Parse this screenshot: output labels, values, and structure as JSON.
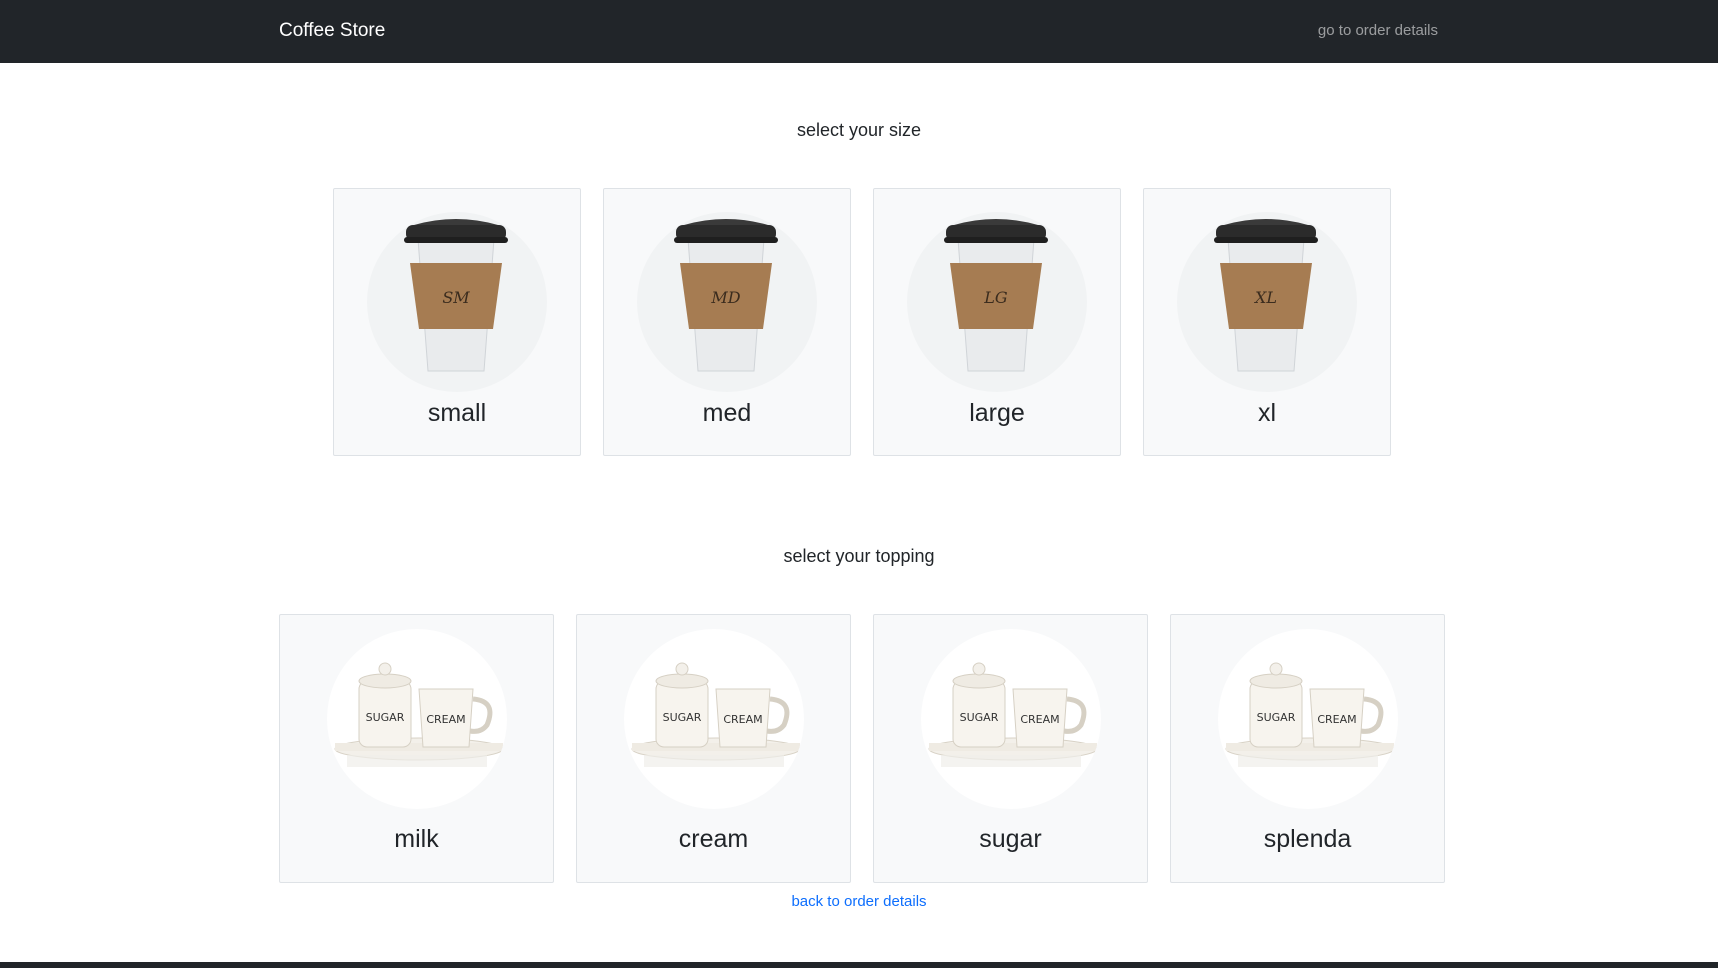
{
  "navbar": {
    "brand": "Coffee Store",
    "order_link": "go to order details"
  },
  "sizes": {
    "title": "select your size",
    "items": [
      {
        "label": "small",
        "cup_text": "SM"
      },
      {
        "label": "med",
        "cup_text": "MD"
      },
      {
        "label": "large",
        "cup_text": "LG"
      },
      {
        "label": "xl",
        "cup_text": "XL"
      }
    ]
  },
  "toppings": {
    "title": "select your topping",
    "jar_text": "SUGAR",
    "pitcher_text": "CREAM",
    "items": [
      {
        "label": "milk"
      },
      {
        "label": "cream"
      },
      {
        "label": "sugar"
      },
      {
        "label": "splenda"
      }
    ]
  },
  "footer": {
    "back_link": "back to order details"
  },
  "colors": {
    "navbar": "#212529",
    "link": "#0d6efd",
    "card_bg": "#f8f9fa",
    "sleeve": "#a67c52",
    "lid": "#2b2b2b"
  }
}
